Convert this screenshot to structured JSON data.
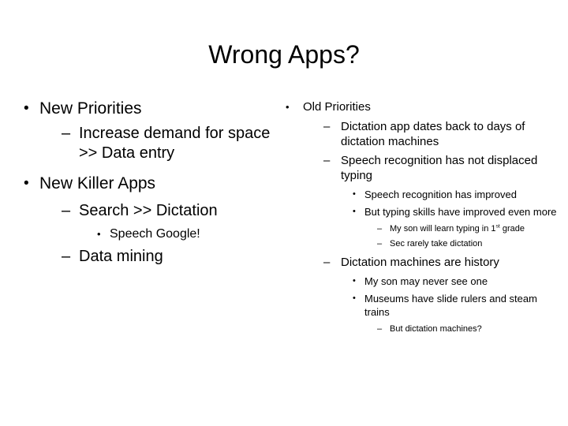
{
  "slide": {
    "title": "Wrong Apps?",
    "background_color": "#ffffff",
    "text_color": "#000000",
    "bullet_marks": {
      "disc": "•",
      "dash": "–"
    },
    "left_column": {
      "items": [
        {
          "level": 1,
          "mark": "•",
          "text": "New Priorities"
        },
        {
          "level": 2,
          "mark": "–",
          "text": "Increase demand for space >> Data entry"
        },
        {
          "level": 1,
          "mark": "•",
          "text": "New Killer Apps"
        },
        {
          "level": 2,
          "mark": "–",
          "text": "Search >> Dictation"
        },
        {
          "level": 3,
          "mark": "•",
          "text": "Speech Google!"
        },
        {
          "level": 2,
          "mark": "–",
          "text": "Data mining"
        }
      ]
    },
    "right_column": {
      "items": [
        {
          "level": 1,
          "mark": "•",
          "text": "Old Priorities"
        },
        {
          "level": 2,
          "mark": "–",
          "text": "Dictation app dates back to days of dictation machines"
        },
        {
          "level": 2,
          "mark": "–",
          "text": "Speech recognition has not displaced typing"
        },
        {
          "level": 3,
          "mark": "•",
          "text": "Speech recognition has improved"
        },
        {
          "level": 3,
          "mark": "•",
          "text": "But typing skills have improved even more"
        },
        {
          "level": 4,
          "mark": "–",
          "text_before_sup": "My son will learn typing in 1",
          "sup": "st",
          "text_after_sup": " grade"
        },
        {
          "level": 4,
          "mark": "–",
          "text": "Sec rarely take dictation"
        },
        {
          "level": 2,
          "mark": "–",
          "text": "Dictation machines are history"
        },
        {
          "level": 3,
          "mark": "•",
          "text": "My son may never see one"
        },
        {
          "level": 3,
          "mark": "•",
          "text": "Museums have slide rulers and steam trains"
        },
        {
          "level": 4,
          "mark": "–",
          "text": "But dictation machines?"
        }
      ]
    }
  }
}
